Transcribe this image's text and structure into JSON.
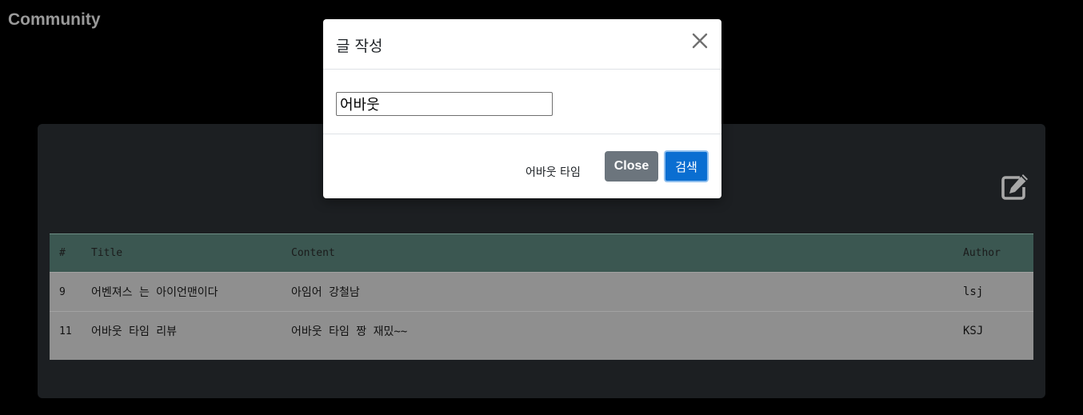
{
  "brand": {
    "title": "Community"
  },
  "board": {
    "write_icon": "edit-icon",
    "columns": {
      "num": "#",
      "title": "Title",
      "content": "Content",
      "author": "Author"
    },
    "rows": [
      {
        "num": "9",
        "title": "어벤져스 는 아이언맨이다",
        "content": "아임어 강철남",
        "author": "lsj"
      },
      {
        "num": "11",
        "title": "어바웃 타임 리뷰",
        "content": "어바웃 타임 짱 재밌~~",
        "author": "KSJ"
      }
    ]
  },
  "modal": {
    "title": "글 작성",
    "close_icon": "close-icon",
    "search_value": "어바웃",
    "footer_text": "어바웃 타임",
    "close_label": "Close",
    "search_label": "검색"
  },
  "colors": {
    "page_bg": "#000000",
    "card_bg": "#1c1f22",
    "table_header_bg": "#3b5751",
    "table_body_bg": "#8f8f8f",
    "close_button": "#6c757d",
    "primary_button": "#0a6ed1"
  }
}
